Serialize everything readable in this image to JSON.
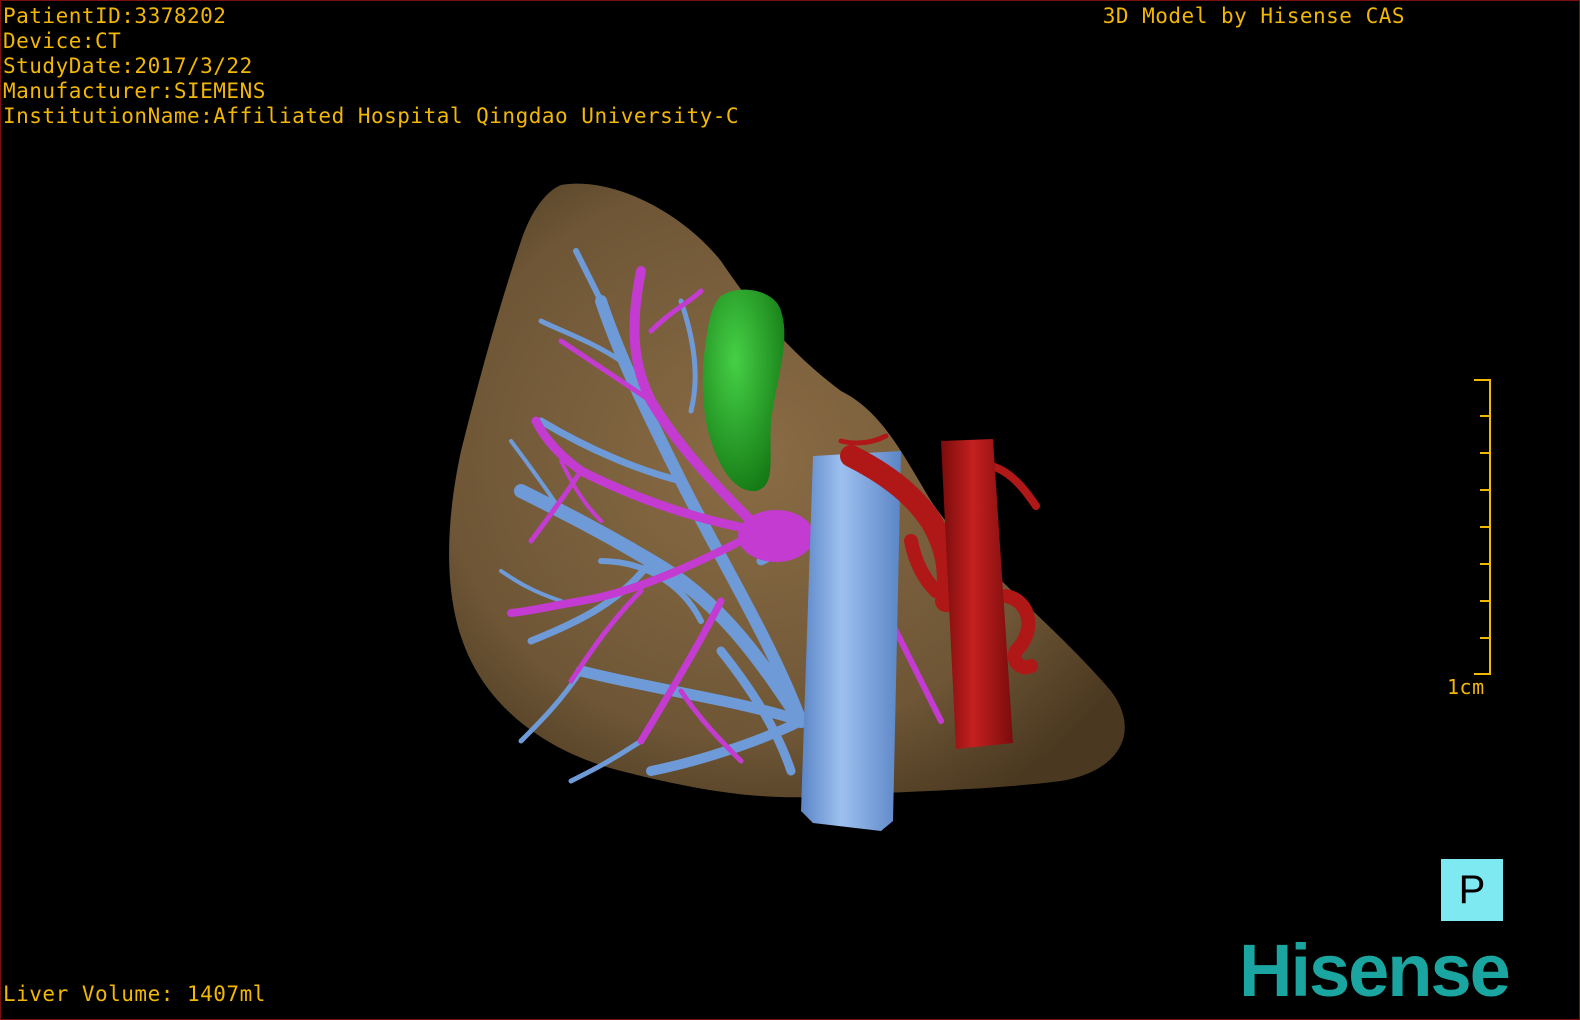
{
  "info": {
    "patient_id": "PatientID:3378202",
    "device": "Device:CT",
    "study_date": "StudyDate:2017/3/22",
    "manufacturer": "Manufacturer:SIEMENS",
    "institution": "InstitutionName:Affiliated Hospital Qingdao University-C"
  },
  "credit": "3D Model by Hisense CAS",
  "liver_volume": "Liver Volume: 1407ml",
  "scale": {
    "label": "1cm"
  },
  "orientation": {
    "label": "P"
  },
  "brand": "Hisense",
  "colors": {
    "overlay_text": "#f2b705",
    "liver": "#6e5636",
    "portal_vein": "#6f9ad8",
    "hepatic_vein": "#c33bd0",
    "gallbladder": "#25a025",
    "artery": "#b01818",
    "orientation_cube": "#7fe9f2",
    "brand": "#1aa5a0",
    "frame_border": "#7a1010"
  }
}
